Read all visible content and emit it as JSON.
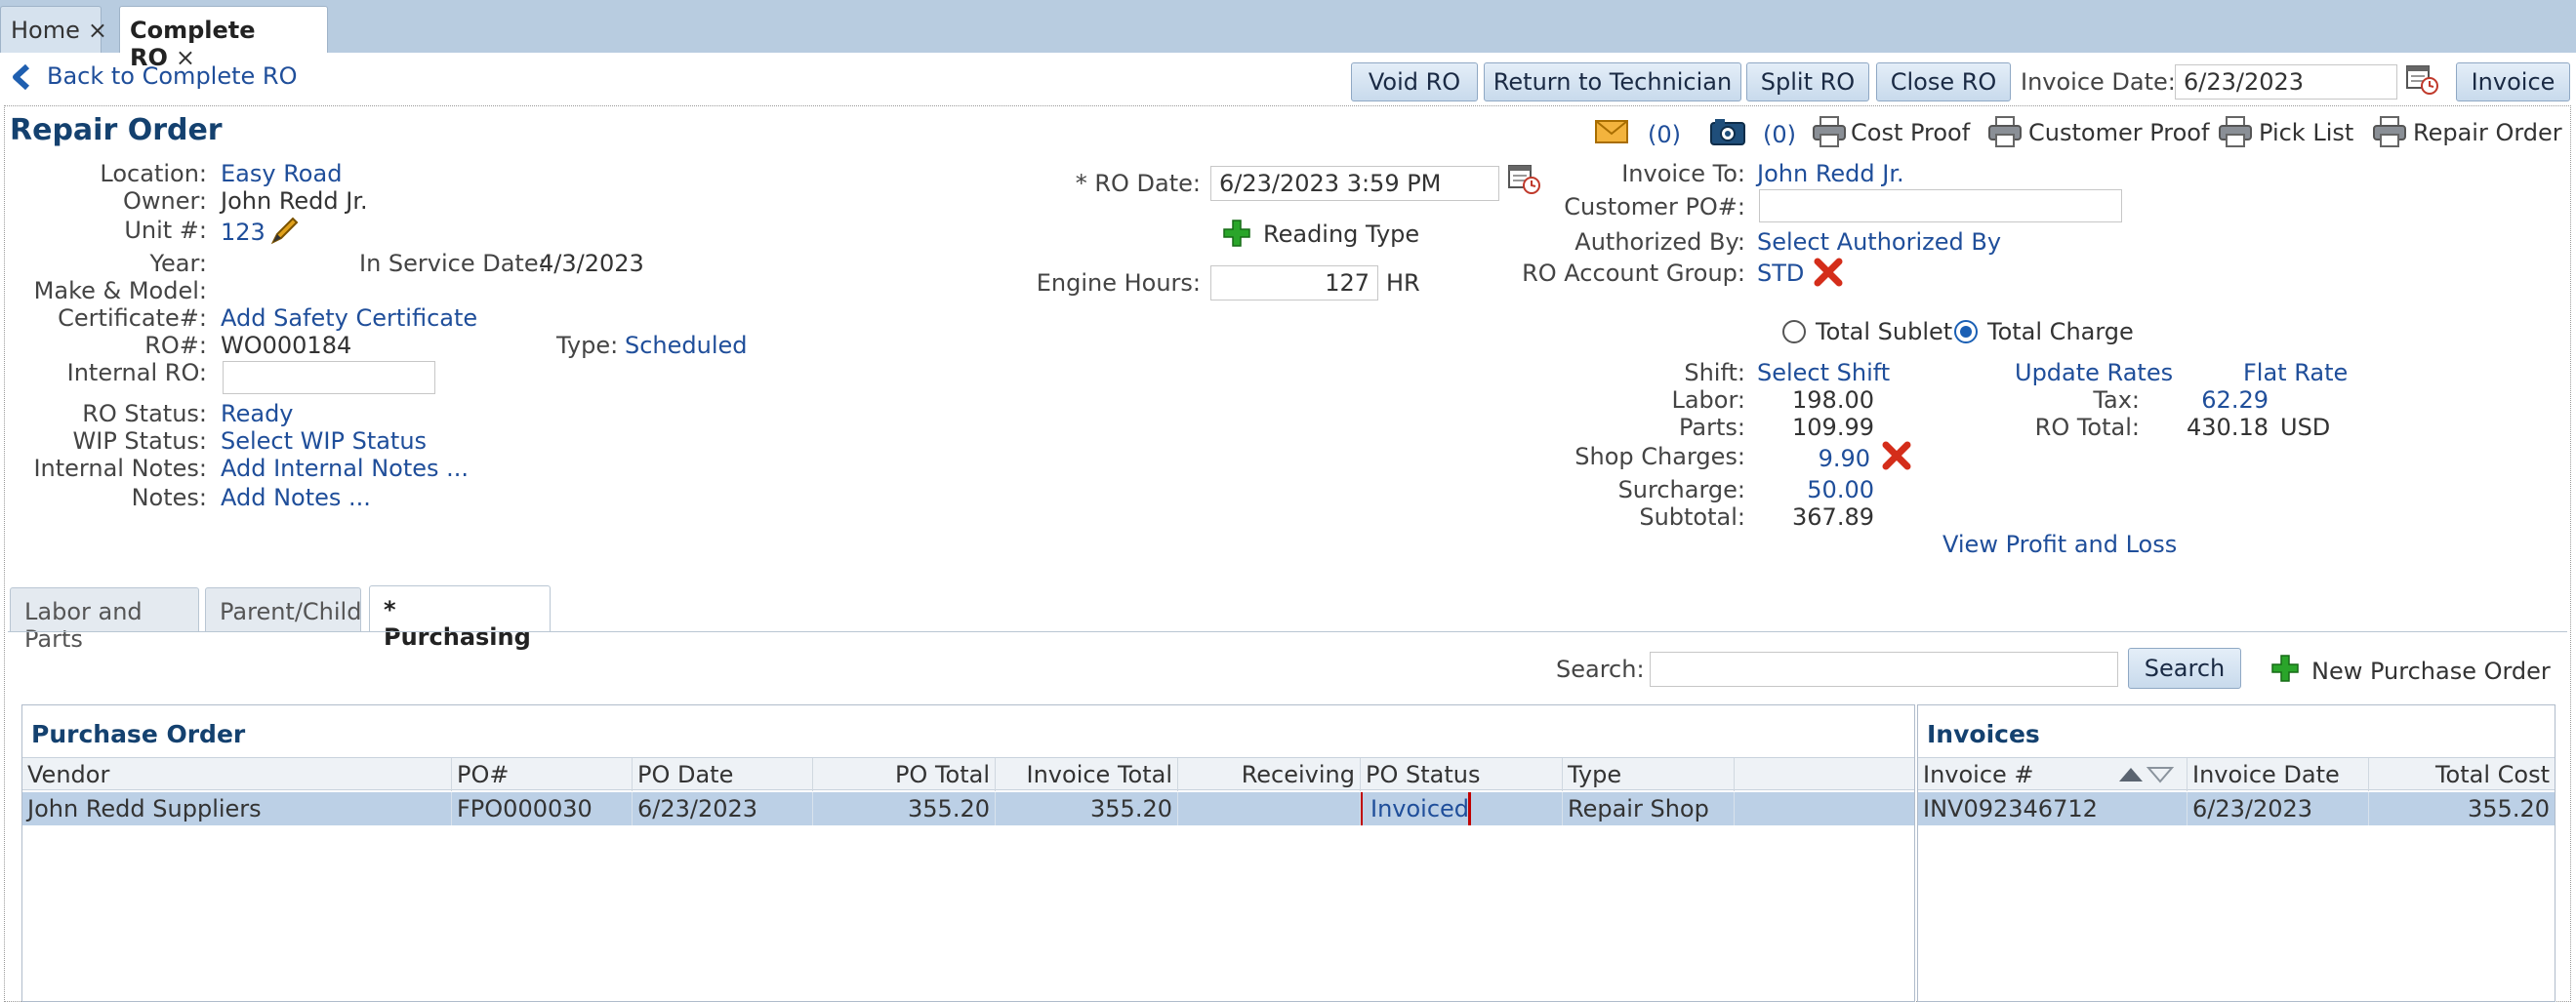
{
  "tabs": [
    {
      "label": "Home",
      "close": "×"
    },
    {
      "label": "Complete RO",
      "close": "×"
    }
  ],
  "toolbar": {
    "back_label": "Back to Complete RO",
    "void": "Void RO",
    "return_tech": "Return to Technician",
    "split": "Split RO",
    "close": "Close RO",
    "invoice_date_label": "Invoice Date:",
    "invoice_date": "6/23/2023",
    "invoice": "Invoice"
  },
  "repair_order": {
    "title": "Repair Order",
    "email_count": "(0)",
    "photo_count": "(0)",
    "print_links": {
      "cost_proof": "Cost Proof",
      "customer_proof": "Customer Proof",
      "pick_list": "Pick List",
      "repair_order": "Repair Order"
    },
    "left": {
      "location_label": "Location:",
      "location": "Easy Road",
      "owner_label": "Owner:",
      "owner": "John Redd Jr.",
      "unit_label": "Unit #:",
      "unit": "123",
      "year_label": "Year:",
      "in_service_label": "In Service Date:",
      "in_service": "4/3/2023",
      "make_model_label": "Make & Model:",
      "certificate_label": "Certificate#:",
      "certificate": "Add Safety Certificate",
      "ro_label": "RO#:",
      "ro": "WO000184",
      "type_label": "Type:",
      "type": "Scheduled",
      "internal_ro_label": "Internal RO:",
      "ro_status_label": "RO Status:",
      "ro_status": "Ready",
      "wip_label": "WIP Status:",
      "wip": "Select WIP Status",
      "internal_notes_label": "Internal Notes:",
      "internal_notes": "Add Internal Notes ...",
      "notes_label": "Notes:",
      "notes": "Add Notes ..."
    },
    "middle": {
      "ro_date_label": "* RO Date:",
      "ro_date": "6/23/2023 3:59 PM",
      "reading_type": "Reading Type",
      "engine_hours_label": "Engine Hours:",
      "engine_hours": "127",
      "engine_hours_unit": "HR"
    },
    "right": {
      "invoice_to_label": "Invoice To:",
      "invoice_to": "John Redd Jr.",
      "customer_po_label": "Customer PO#:",
      "authorized_by_label": "Authorized By:",
      "authorized_by": "Select Authorized By",
      "account_group_label": "RO Account Group:",
      "account_group": "STD",
      "total_sublet": "Total Sublet",
      "total_charge": "Total Charge",
      "shift_label": "Shift:",
      "shift": "Select Shift",
      "update_rates": "Update Rates",
      "flat_rate": "Flat Rate",
      "labor_label": "Labor:",
      "labor": "198.00",
      "parts_label": "Parts:",
      "parts": "109.99",
      "shop_charges_label": "Shop Charges:",
      "shop_charges": "9.90",
      "surcharge_label": "Surcharge:",
      "surcharge": "50.00",
      "subtotal_label": "Subtotal:",
      "subtotal": "367.89",
      "tax_label": "Tax:",
      "tax": "62.29",
      "ro_total_label": "RO Total:",
      "ro_total": "430.18",
      "currency": "USD",
      "profit_loss": "View Profit and Loss"
    }
  },
  "sub_tabs": [
    {
      "label": "Labor and Parts"
    },
    {
      "label": "Parent/Child"
    },
    {
      "label": "* Purchasing"
    }
  ],
  "purchasing": {
    "search_label": "Search:",
    "search_button": "Search",
    "new_po": "New Purchase Order",
    "po_panel_title": "Purchase Order",
    "po_columns": [
      "Vendor",
      "PO#",
      "PO Date",
      "PO Total",
      "Invoice Total",
      "Receiving Cost",
      "PO Status",
      "Type"
    ],
    "po_rows": [
      {
        "vendor": "John Redd Suppliers",
        "po": "FPO000030",
        "po_date": "6/23/2023",
        "po_total": "355.20",
        "invoice_total": "355.20",
        "receiving_cost": "",
        "status": "Invoiced",
        "type": "Repair Shop ..."
      }
    ],
    "inv_panel_title": "Invoices",
    "inv_columns": [
      "Invoice #",
      "Invoice Date",
      "Total Cost"
    ],
    "inv_rows": [
      {
        "invoice": "INV092346712",
        "date": "6/23/2023",
        "total": "355.20"
      }
    ]
  },
  "colors": {
    "link": "#1f4e9a",
    "highlight_border": "#c00000",
    "row_selected": "#bcd0e6"
  }
}
